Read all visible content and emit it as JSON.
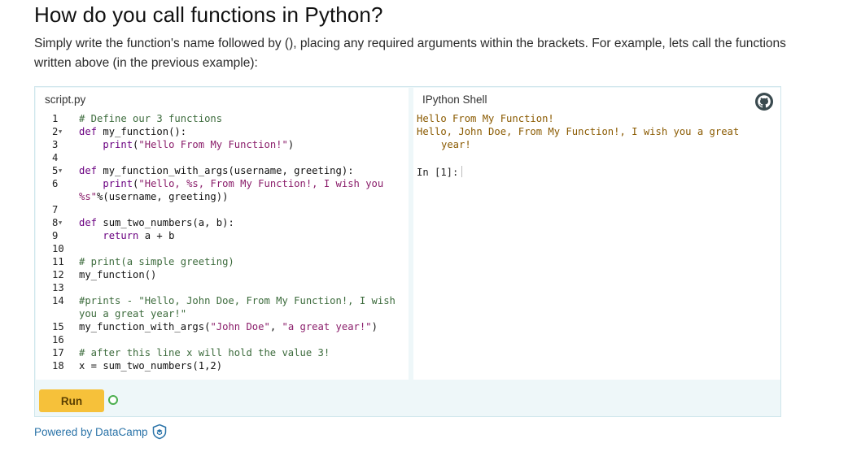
{
  "heading": "How do you call functions in Python?",
  "intro": "Simply write the function's name followed by (), placing any required arguments within the brackets. For example, lets call the functions written above (in the previous example):",
  "editor": {
    "tab_label": "script.py",
    "lines": [
      {
        "n": "1",
        "fold": false,
        "text": "# Define our 3 functions"
      },
      {
        "n": "2",
        "fold": true,
        "text": "def my_function():"
      },
      {
        "n": "3",
        "fold": false,
        "text": "    print(\"Hello From My Function!\")"
      },
      {
        "n": "4",
        "fold": false,
        "text": ""
      },
      {
        "n": "5",
        "fold": true,
        "text": "def my_function_with_args(username, greeting):"
      },
      {
        "n": "6",
        "fold": false,
        "text": "    print(\"Hello, %s, From My Function!, I wish you %s\"%(username, greeting))"
      },
      {
        "n": "7",
        "fold": false,
        "text": ""
      },
      {
        "n": "8",
        "fold": true,
        "text": "def sum_two_numbers(a, b):"
      },
      {
        "n": "9",
        "fold": false,
        "text": "    return a + b"
      },
      {
        "n": "10",
        "fold": false,
        "text": ""
      },
      {
        "n": "11",
        "fold": false,
        "text": "# print(a simple greeting)"
      },
      {
        "n": "12",
        "fold": false,
        "text": "my_function()"
      },
      {
        "n": "13",
        "fold": false,
        "text": ""
      },
      {
        "n": "14",
        "fold": false,
        "text": "#prints - \"Hello, John Doe, From My Function!, I wish you a great year!\""
      },
      {
        "n": "15",
        "fold": false,
        "text": "my_function_with_args(\"John Doe\", \"a great year!\")"
      },
      {
        "n": "16",
        "fold": false,
        "text": ""
      },
      {
        "n": "17",
        "fold": false,
        "text": "# after this line x will hold the value 3!"
      },
      {
        "n": "18",
        "fold": false,
        "text": "x = sum_two_numbers(1,2)"
      }
    ]
  },
  "shell": {
    "tab_label": "IPython Shell",
    "output_line_1": "Hello From My Function!",
    "output_line_2": "Hello, John Doe, From My Function!, I wish you a great",
    "output_line_3": "year!",
    "prompt": "In [1]:"
  },
  "run_label": "Run",
  "powered_by": "Powered by DataCamp",
  "colors": {
    "run_button": "#f6c13a",
    "status_ring": "#4caf50",
    "shell_output": "#8a5a00",
    "link": "#2a73a8"
  }
}
